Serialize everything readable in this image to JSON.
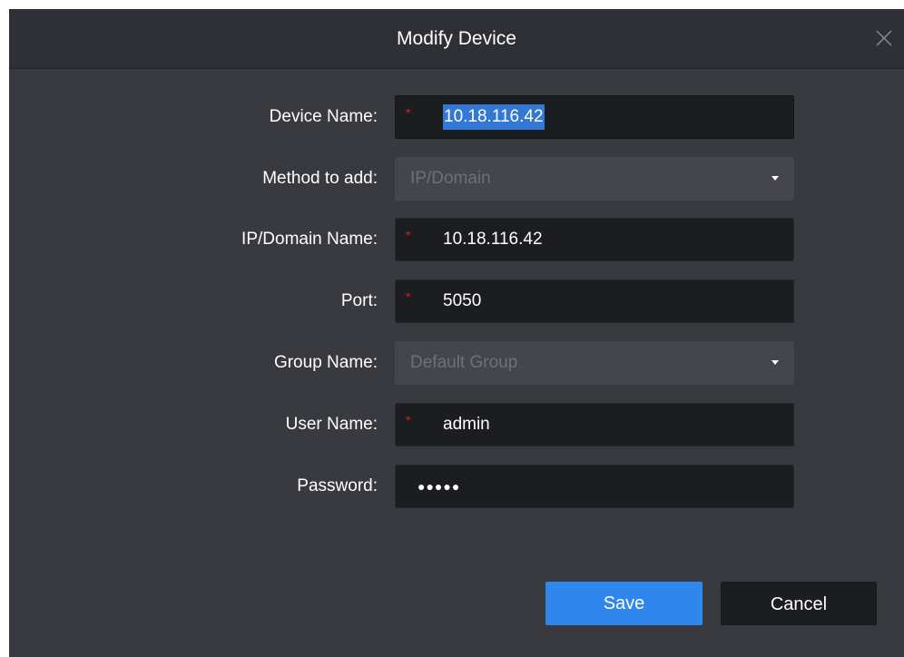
{
  "dialog": {
    "title": "Modify Device"
  },
  "fields": {
    "device_name": {
      "label": "Device Name:",
      "value": "10.18.116.42",
      "required": "*"
    },
    "method": {
      "label": "Method to add:",
      "value": "IP/Domain"
    },
    "ip_domain": {
      "label": "IP/Domain Name:",
      "value": "10.18.116.42",
      "required": "*"
    },
    "port": {
      "label": "Port:",
      "value": "5050",
      "required": "*"
    },
    "group": {
      "label": "Group Name:",
      "value": "Default Group"
    },
    "username": {
      "label": "User Name:",
      "value": "admin",
      "required": "*"
    },
    "password": {
      "label": "Password:",
      "value": "●●●●●"
    }
  },
  "buttons": {
    "save": "Save",
    "cancel": "Cancel"
  },
  "icons": {
    "close": "close-icon",
    "dropdown": "chevron-down-icon"
  },
  "colors": {
    "accent": "#2f86ec",
    "required": "#e02020",
    "selection": "#3478d6",
    "dialog_bg": "#393a3f",
    "titlebar_bg": "#2f3035",
    "input_bg": "#1c1d21",
    "select_bg": "#45464d"
  }
}
